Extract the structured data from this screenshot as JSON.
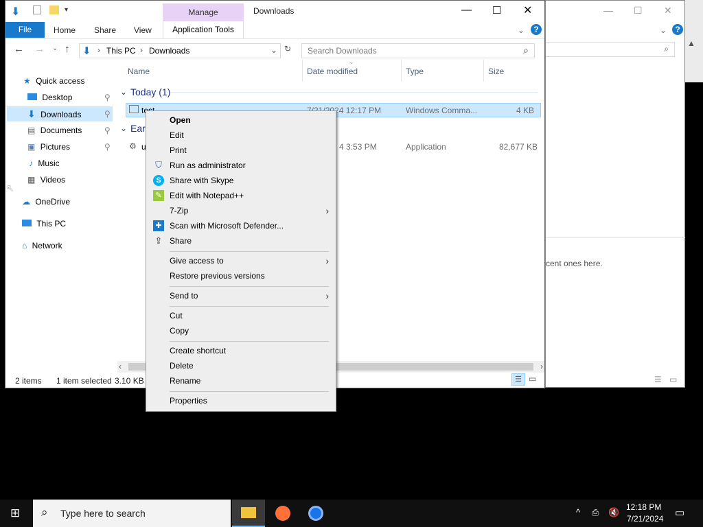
{
  "background_window": {
    "empty_message": "cent ones here."
  },
  "quick_access_toolbar": {
    "icons": [
      "down-arrow-icon",
      "properties-icon",
      "new-folder-icon",
      "customize-dropdown-icon"
    ]
  },
  "window": {
    "title": "Downloads",
    "controls": [
      "minimize",
      "maximize",
      "close"
    ]
  },
  "ribbon": {
    "context_group": "Manage",
    "tabs": [
      "File",
      "Home",
      "Share",
      "View",
      "Application Tools"
    ]
  },
  "address_bar": {
    "crumbs": [
      "This PC",
      "Downloads"
    ],
    "search_placeholder": "Search Downloads"
  },
  "nav_pane": {
    "items": [
      {
        "label": "Quick access",
        "icon": "star-icon"
      },
      {
        "label": "Desktop",
        "icon": "desktop-icon",
        "pinned": true
      },
      {
        "label": "Downloads",
        "icon": "download-icon",
        "pinned": true,
        "selected": true
      },
      {
        "label": "Documents",
        "icon": "documents-icon",
        "pinned": true
      },
      {
        "label": "Pictures",
        "icon": "pictures-icon",
        "pinned": true
      },
      {
        "label": "Music",
        "icon": "music-icon"
      },
      {
        "label": "Videos",
        "icon": "videos-icon"
      },
      {
        "label": "OneDrive",
        "icon": "cloud-icon"
      },
      {
        "label": "This PC",
        "icon": "computer-icon"
      },
      {
        "label": "Network",
        "icon": "network-icon"
      }
    ]
  },
  "columns": [
    "Name",
    "Date modified",
    "Type",
    "Size"
  ],
  "groups": [
    {
      "label": "Today (1)"
    },
    {
      "label": "Earl"
    }
  ],
  "files": [
    {
      "name": "test",
      "date": "7/21/2024 12:17 PM",
      "type": "Windows Comma...",
      "size": "4 KB",
      "selected": true
    },
    {
      "name": "u",
      "date": "4 3:53 PM",
      "type": "Application",
      "size": "82,677 KB",
      "selected": false
    }
  ],
  "status_bar": {
    "count": "2 items",
    "selection": "1 item selected",
    "size": "3.10 KB"
  },
  "context_menu": {
    "items": [
      {
        "label": "Open",
        "bold": true
      },
      {
        "label": "Edit"
      },
      {
        "label": "Print"
      },
      {
        "label": "Run as administrator",
        "icon": "uac-shield-icon"
      },
      {
        "label": "Share with Skype",
        "icon": "skype-icon"
      },
      {
        "label": "Edit with Notepad++",
        "icon": "notepadpp-icon"
      },
      {
        "label": "7-Zip",
        "submenu": true
      },
      {
        "label": "Scan with Microsoft Defender...",
        "icon": "defender-icon"
      },
      {
        "label": "Share",
        "icon": "share-icon"
      },
      {
        "label": "Give access to",
        "submenu": true
      },
      {
        "label": "Restore previous versions"
      },
      {
        "label": "Send to",
        "submenu": true
      },
      {
        "label": "Cut"
      },
      {
        "label": "Copy"
      },
      {
        "label": "Create shortcut"
      },
      {
        "label": "Delete"
      },
      {
        "label": "Rename"
      },
      {
        "label": "Properties"
      }
    ]
  },
  "taskbar": {
    "search_placeholder": "Type here to search",
    "apps": [
      "file-explorer-icon",
      "firefox-icon",
      "chrome-icon"
    ],
    "time": "12:18 PM",
    "date": "7/21/2024"
  },
  "colors": {
    "accent": "#1979ca",
    "selection": "#cce8ff",
    "manage_tab": "#e8d2f5",
    "taskbar": "#101010"
  }
}
